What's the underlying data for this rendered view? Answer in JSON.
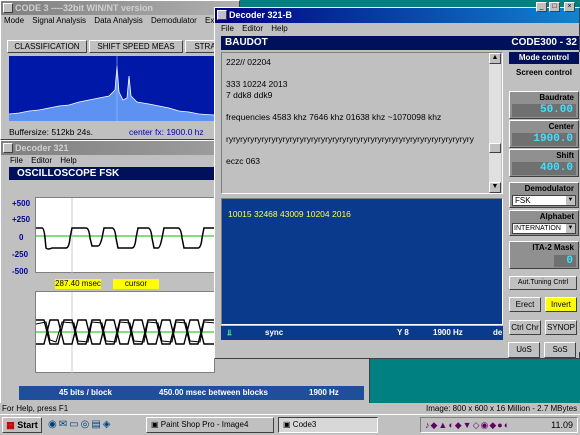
{
  "code3": {
    "title": "CODE 3 ----32bit WIN/NT version",
    "menu": [
      "Mode",
      "Signal Analysis",
      "Data Analysis",
      "Demodulator",
      "Ex"
    ],
    "tabs": [
      "CLASSIFICATION",
      "SHIFT SPEED MEAS",
      "STRA"
    ],
    "buffersize": "Buffersize: 512kb  24s.",
    "center_fx": "center fx:  1900.0 hz"
  },
  "decoder_back": {
    "title": "Decoder 321",
    "menu": [
      "File",
      "Editor",
      "Help"
    ],
    "header": "OSCILLOSCOPE  FSK",
    "y_labels": [
      "+500",
      "+250",
      "0",
      "-250",
      "-500"
    ],
    "msec": "287.40 msec",
    "cursor": "cursor",
    "footer_bits": "45 bits / block",
    "footer_msec": "450.00 msec between blocks",
    "footer_hz": "1900 Hz"
  },
  "decoder_front": {
    "title": "Decoder 321-B",
    "menu": [
      "File",
      "Editor",
      "Help"
    ],
    "header_left": "BAUDOT",
    "header_right": "CODE300 - 32",
    "lines": [
      "222// 02204",
      "",
      "  333 10224 2013",
      "7 ddk8 ddk9",
      "",
      "frequencies   4583 khz   7646 khz   01638 khz ~1070098 khz",
      "",
      "ryryryryryryryryryryryryryryryryryryryryryryryryryryryryryryryryryryry",
      "",
      "eczc 063"
    ],
    "blue_text": "10015 32468 43009 10204 2016",
    "status_sync": "sync",
    "status_y": "Y 8",
    "status_hz": "1900 Hz",
    "status_end": "de"
  },
  "control": {
    "mode": "Mode control",
    "screen": "Screen control",
    "baudrate_label": "Baudrate",
    "baudrate_value": "50.00",
    "center_label": "Center",
    "center_value": "1900.0",
    "shift_label": "Shift",
    "shift_value": "400.0",
    "demod_label": "Demodulator",
    "demod_value": "FSK",
    "alphabet_label": "Alphabet",
    "alphabet_value": "INTERNATION",
    "ita_label": "ITA-2 Mask",
    "ita_value": "0",
    "aut_tuning": "Aut.Tuning Cntrl",
    "erect": "Erect",
    "invert": "Invert",
    "ctrl_chr": "Ctrl Chr",
    "synop": "SYNOP",
    "uos": "UoS",
    "sos": "SoS"
  },
  "status": {
    "help": "For Help, press F1",
    "image": "Image:  800 x 600 x 16 Million - 2.7 MBytes"
  },
  "taskbar": {
    "start": "Start",
    "tasks": [
      "Paint Shop Pro - Image4",
      "Code3"
    ],
    "clock": "11.09"
  },
  "colors": {
    "desktop": "#008080",
    "title_active": "#000080",
    "plot_blue": "#0020a0",
    "lcd_text": "#3fe0ff",
    "highlight_yellow": "#ffff00"
  }
}
